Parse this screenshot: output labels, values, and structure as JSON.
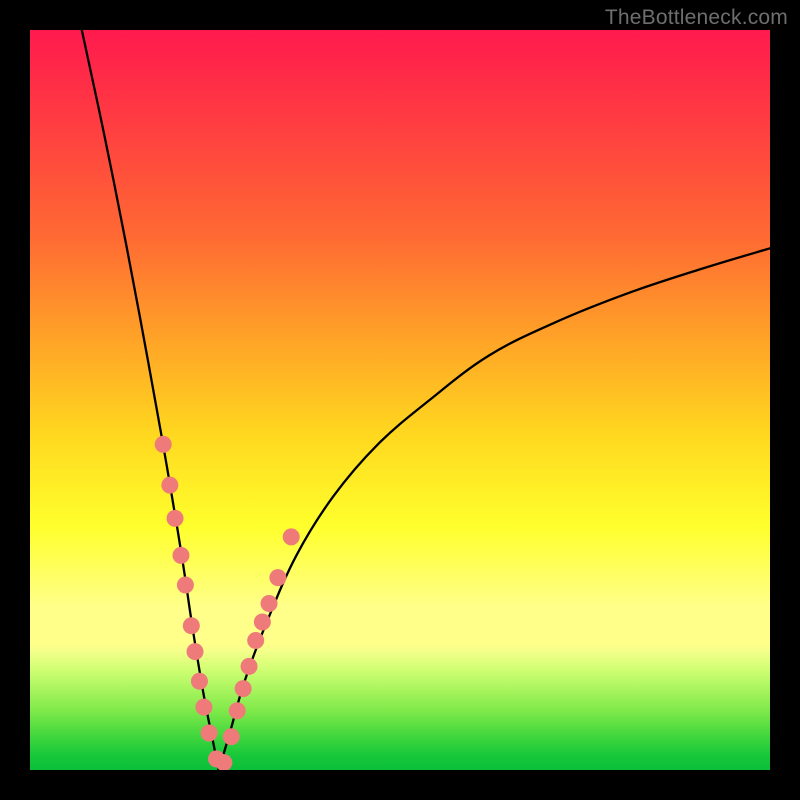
{
  "watermark": "TheBottleneck.com",
  "colors": {
    "dot_fill": "#ef7a7a",
    "curve_stroke": "#000000",
    "frame_bg": "#000000"
  },
  "chart_data": {
    "type": "line",
    "title": "",
    "xlabel": "",
    "ylabel": "",
    "xlim": [
      0,
      100
    ],
    "ylim": [
      0,
      100
    ],
    "grid": false,
    "legend": false,
    "axes_visible": false,
    "note": "Values are read off the plot in percent of each axis (0–100). The curve is a V-shaped bottleneck profile; left branch descends from near 100 to 0 around x≈25, right branch ascends toward ~70 at x=100. Dot series marks highlighted sample points along both branches near the valley.",
    "series": [
      {
        "name": "curve-left",
        "role": "line",
        "x": [
          7,
          10,
          13,
          16,
          18.5,
          20.5,
          22,
          23.5,
          24.7,
          25.5
        ],
        "y": [
          100,
          86,
          71,
          55,
          41,
          29,
          19,
          10,
          4,
          0
        ]
      },
      {
        "name": "curve-right",
        "role": "line",
        "x": [
          25.5,
          27,
          29,
          32,
          36,
          41,
          47,
          54,
          62,
          71,
          81,
          91,
          100
        ],
        "y": [
          0,
          5,
          12,
          20,
          29,
          37,
          44,
          50,
          56,
          60.5,
          64.5,
          67.8,
          70.5
        ]
      },
      {
        "name": "dots-left",
        "role": "scatter",
        "x": [
          18.0,
          18.9,
          19.6,
          20.4,
          21.0,
          21.8,
          22.3,
          22.9,
          23.5,
          24.2,
          25.2,
          26.2
        ],
        "y": [
          44.0,
          38.5,
          34.0,
          29.0,
          25.0,
          19.5,
          16.0,
          12.0,
          8.5,
          5.0,
          1.5,
          1.0
        ]
      },
      {
        "name": "dots-right",
        "role": "scatter",
        "x": [
          27.2,
          28.0,
          28.8,
          29.6,
          30.5,
          31.4,
          32.3,
          33.5,
          35.3
        ],
        "y": [
          4.5,
          8.0,
          11.0,
          14.0,
          17.5,
          20.0,
          22.5,
          26.0,
          31.5
        ]
      }
    ],
    "dot_radius_px": 8.5
  }
}
